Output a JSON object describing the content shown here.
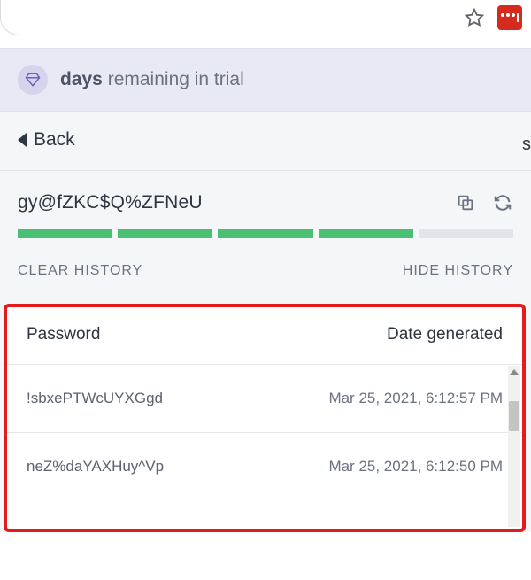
{
  "trial": {
    "bold": "days",
    "rest": " remaining in trial"
  },
  "back": {
    "label": "Back"
  },
  "generator": {
    "password": "gy@fZKC$Q%ZFNeU",
    "strength_segments": 5,
    "strength_filled": 4
  },
  "controls": {
    "clear": "CLEAR HISTORY",
    "hide": "HIDE HISTORY"
  },
  "history": {
    "head_password": "Password",
    "head_date": "Date generated",
    "rows": [
      {
        "password": "!sbxePTWcUYXGgd",
        "date": "Mar 25, 2021, 6:12:57 PM"
      },
      {
        "password": "neZ%daYAXHuy^Vp",
        "date": "Mar 25, 2021, 6:12:50 PM"
      }
    ]
  },
  "side_letter": "s"
}
